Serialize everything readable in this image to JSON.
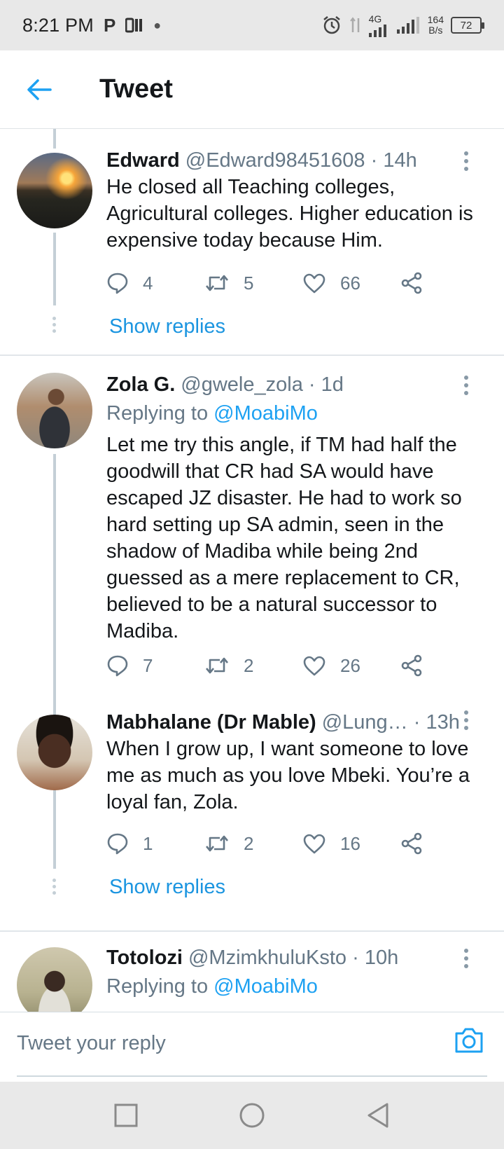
{
  "status_bar": {
    "time": "8:21 PM",
    "net_type": "4G",
    "speed_value": "164",
    "speed_unit": "B/s",
    "battery": "72"
  },
  "header": {
    "title": "Tweet"
  },
  "tweets": [
    {
      "name": "Edward",
      "handle": "@Edward98451608",
      "time": "· 14h",
      "text": "He closed all Teaching colleges, Agricultural colleges. Higher education is expensive today because  Him.",
      "replies": "4",
      "retweets": "5",
      "likes": "66"
    },
    {
      "name": "Zola G.",
      "handle": "@gwele_zola",
      "time": "· 1d",
      "replying_label": "Replying to",
      "replying_to": "@MoabiMo",
      "text": "Let me try this angle, if TM had half the goodwill that CR had SA would have escaped JZ disaster. He had to work so hard setting up SA admin, seen in the shadow of Madiba while being 2nd guessed as a mere replacement to CR, believed to be a natural successor to Madiba.",
      "replies": "7",
      "retweets": "2",
      "likes": "26"
    },
    {
      "name": "Mabhalane (Dr Mable)",
      "handle": "@Lung…",
      "time": "· 13h",
      "text": "When I grow up, I want someone to love me as much as you love Mbeki. You’re a loyal fan, Zola.",
      "replies": "1",
      "retweets": "2",
      "likes": "16"
    },
    {
      "name": "Totolozi",
      "handle": "@MzimkhuluKsto",
      "time": "· 10h",
      "replying_label": "Replying to",
      "replying_to": "@MoabiMo"
    }
  ],
  "show_replies_label": "Show replies",
  "composer": {
    "placeholder": "Tweet your reply"
  },
  "colors": {
    "accent": "#1da1f2",
    "link": "#1b95e0",
    "muted": "#657786",
    "text": "#14171a"
  }
}
